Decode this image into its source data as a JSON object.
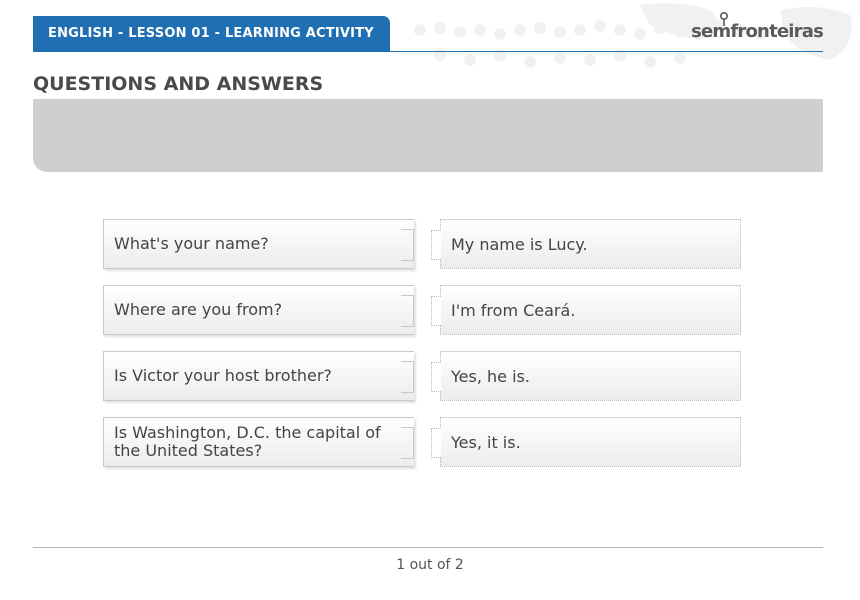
{
  "header": {
    "title": "ENGLISH - LESSON 01 - LEARNING ACTIVITY",
    "logo_text": "semfronteiras"
  },
  "section": {
    "title": "QUESTIONS AND ANSWERS",
    "instructions": ""
  },
  "pairs": [
    {
      "question": "What's your name?",
      "answer": "My name is Lucy."
    },
    {
      "question": "Where are you from?",
      "answer": "I'm from Ceará."
    },
    {
      "question": "Is Victor your host brother?",
      "answer": "Yes, he is."
    },
    {
      "question": "Is Washington, D.C. the capital of the United States?",
      "answer": "Yes, it is."
    }
  ],
  "pager": {
    "current": "1",
    "separator": "out of",
    "total": "2"
  },
  "colors": {
    "header_blue": "#1f6fb2",
    "instruction_gray": "#cfcfcf"
  },
  "icons": {
    "logo_pin": "map-pin-icon",
    "background": "world-map-icon"
  }
}
